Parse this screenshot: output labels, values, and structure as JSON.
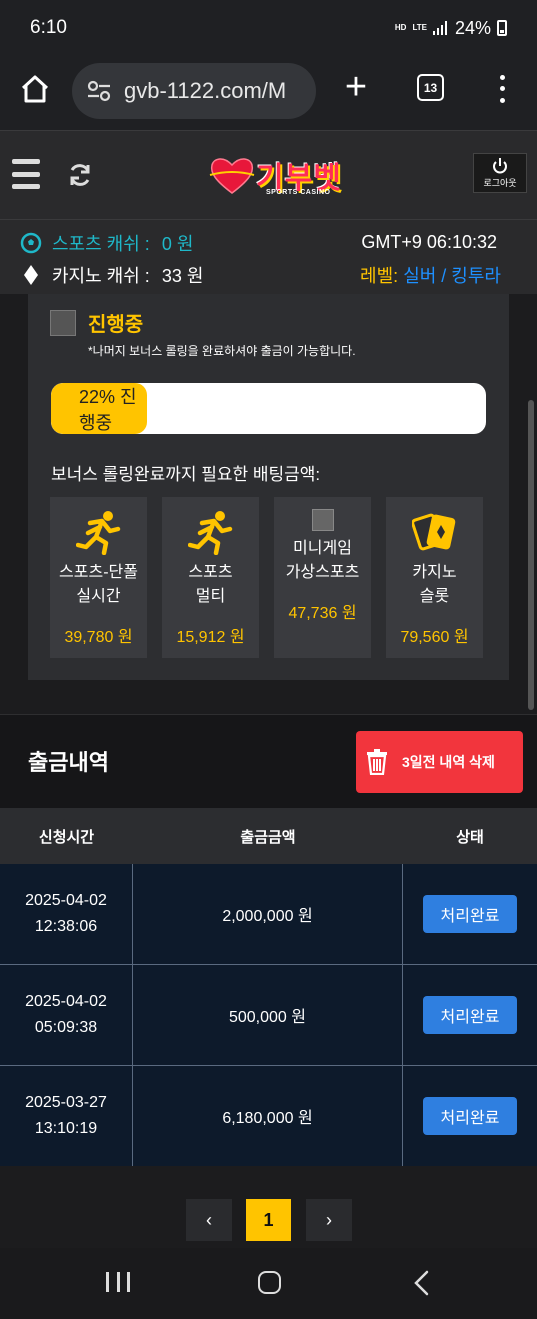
{
  "status_bar": {
    "time": "6:10",
    "net_hd": "HD",
    "net_lte": "LTE",
    "battery": "24%"
  },
  "browser": {
    "url": "gvb-1122.com/M",
    "tab_count": "13"
  },
  "site": {
    "logo_text": "기부벳",
    "logo_sub": "SPORTS CASINO",
    "logout_label": "로그아웃"
  },
  "account": {
    "sports_cash_label": "스포츠 캐쉬 :",
    "sports_cash_value": "0 원",
    "casino_cash_label": "카지노 캐쉬 :",
    "casino_cash_value": "33 원",
    "gmt": "GMT+9 06:10:32",
    "level_label": "레벨:",
    "level_value": "실버 / 킹투라"
  },
  "bonus": {
    "title": "진행중",
    "note": "*나머지 보너스 롤링을 완료하셔야 출금이 가능합니다.",
    "progress_label": "22% 진행중",
    "progress_percent": 22,
    "required_label": "보너스 롤링완료까지 필요한 배팅금액:",
    "cards": [
      {
        "name1": "스포츠-단폴",
        "name2": "실시간",
        "amount": "39,780 원",
        "icon": "running-man-icon"
      },
      {
        "name1": "스포츠",
        "name2": "멀티",
        "amount": "15,912 원",
        "icon": "running-man-icon"
      },
      {
        "name1": "미니게임",
        "name2": "가상스포츠",
        "amount": "47,736 원",
        "icon": "broken-image-icon"
      },
      {
        "name1": "카지노",
        "name2": "슬롯",
        "amount": "79,560 원",
        "icon": "playing-cards-icon"
      }
    ]
  },
  "withdrawals": {
    "title": "출금내역",
    "delete_label": "3일전 내역 삭제",
    "headers": [
      "신청시간",
      "출금금액",
      "상태"
    ],
    "rows": [
      {
        "date": "2025-04-02",
        "time": "12:38:06",
        "amount": "2,000,000 원",
        "status": "처리완료"
      },
      {
        "date": "2025-04-02",
        "time": "05:09:38",
        "amount": "500,000 원",
        "status": "처리완료"
      },
      {
        "date": "2025-03-27",
        "time": "13:10:19",
        "amount": "6,180,000 원",
        "status": "처리완료"
      }
    ]
  },
  "pagination": {
    "prev": "‹",
    "current": "1",
    "next": "›"
  },
  "colors": {
    "accent_yellow": "#ffc400",
    "sports_teal": "#1fb8c9",
    "level_blue": "#1e90ff",
    "delete_red": "#f2353d",
    "status_blue": "#2f7fe0"
  }
}
